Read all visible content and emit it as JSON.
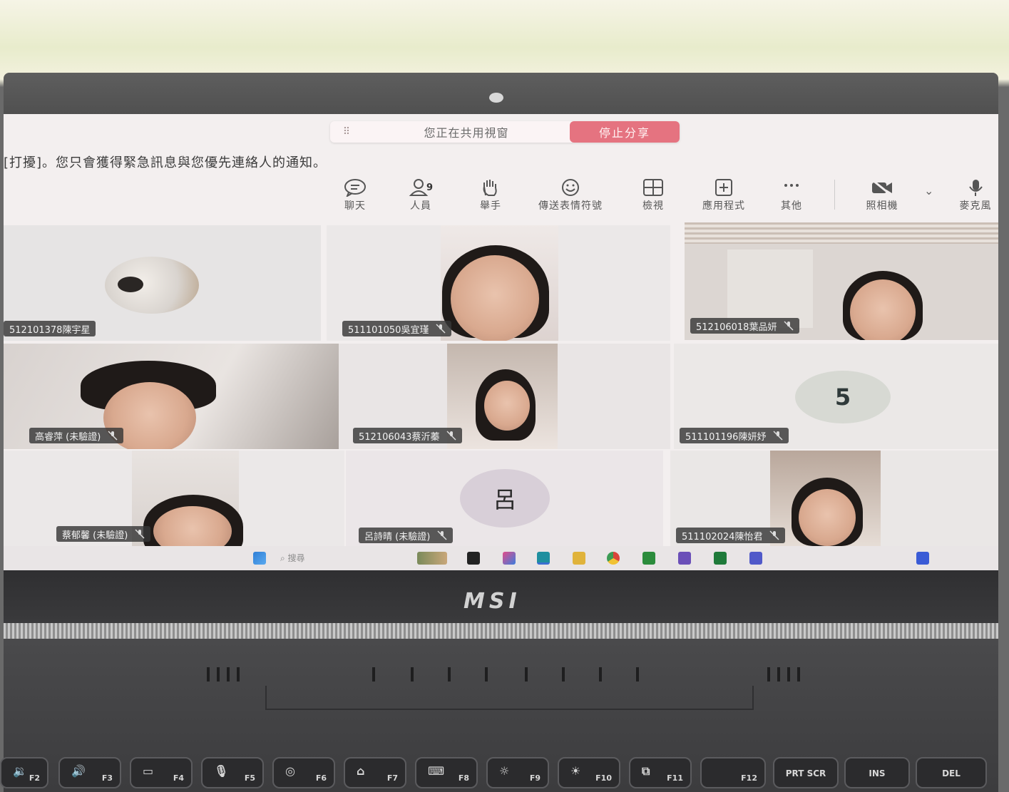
{
  "screen": {
    "share_bar": {
      "grip": "⠿",
      "status": "您正在共用視窗",
      "stop_label": "停止分享"
    },
    "notice": "[打擾]。您只會獲得緊急訊息與您優先連絡人的通知。",
    "toolbar": {
      "chat_label": "聊天",
      "people_label": "人員",
      "people_count": "9",
      "raise_hand_label": "舉手",
      "reactions_label": "傳送表情符號",
      "view_label": "檢視",
      "apps_label": "應用程式",
      "more_label": "其他",
      "camera_label": "照相機",
      "mic_label": "麥克風"
    },
    "participants": [
      {
        "name": "512101378陳宇星"
      },
      {
        "name": "511101050吳宜瑾"
      },
      {
        "name": "512106018葉品妍"
      },
      {
        "name": "高睿萍 (未驗證)"
      },
      {
        "name": "512106043蔡沂蓁"
      },
      {
        "name": "511101196陳妍妤",
        "avatar_text": "5"
      },
      {
        "name": "蔡郁馨 (未驗證)"
      },
      {
        "name": "呂詩晴 (未驗證)",
        "avatar_text": "呂"
      },
      {
        "name": "511102024陳怡君"
      }
    ],
    "taskbar": {
      "search_label": "搜尋"
    }
  },
  "laptop": {
    "brand": "MSI",
    "keys": [
      {
        "fn": "F2",
        "icon": "volume-down-icon",
        "glyph": "🔉"
      },
      {
        "fn": "F3",
        "icon": "volume-up-icon",
        "glyph": "🔊"
      },
      {
        "fn": "F4",
        "icon": "display-off-icon",
        "glyph": "▭"
      },
      {
        "fn": "F5",
        "icon": "mic-mute-icon",
        "glyph": "🎙"
      },
      {
        "fn": "F6",
        "icon": "webcam-icon",
        "glyph": "◎"
      },
      {
        "fn": "F7",
        "icon": "user-scenario-icon",
        "glyph": "⌂"
      },
      {
        "fn": "F8",
        "icon": "keyboard-backlight-icon",
        "glyph": "⌨"
      },
      {
        "fn": "F9",
        "icon": "brightness-down-icon",
        "glyph": "☼"
      },
      {
        "fn": "F10",
        "icon": "brightness-up-icon",
        "glyph": "☀"
      },
      {
        "fn": "F11",
        "icon": "display-switch-icon",
        "glyph": "⧉"
      },
      {
        "fn": "F12",
        "icon": "",
        "glyph": ""
      },
      {
        "label": "PRT SCR"
      },
      {
        "label": "INS"
      },
      {
        "label": "DEL"
      }
    ]
  }
}
